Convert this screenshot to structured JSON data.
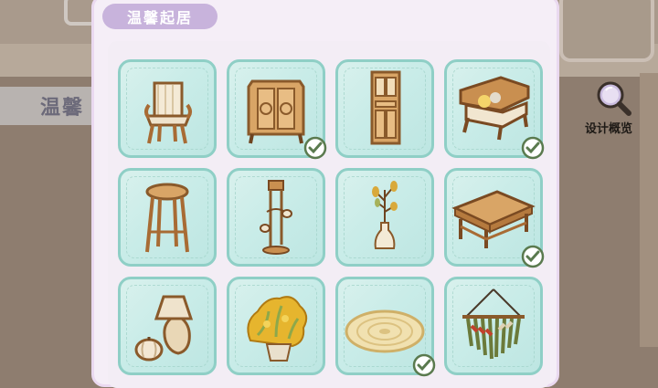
{
  "background": {
    "left_label": "温馨"
  },
  "panel": {
    "title": "温馨起居"
  },
  "overview_button": {
    "label": "设计概览",
    "icon": "magnifier-icon"
  },
  "colors": {
    "tile_fill": "#c9ece8",
    "tile_border": "#8fcfc6",
    "check": "#5a7a4e",
    "title_pill": "#c8b3dc"
  },
  "items": [
    {
      "name": "rattan-armchair",
      "owned": false
    },
    {
      "name": "wooden-cabinet",
      "owned": true
    },
    {
      "name": "tall-bookcase",
      "owned": false
    },
    {
      "name": "rattan-sofa",
      "owned": true
    },
    {
      "name": "bar-stool",
      "owned": false
    },
    {
      "name": "floor-lamp",
      "owned": false
    },
    {
      "name": "branch-vase",
      "owned": false
    },
    {
      "name": "wooden-table",
      "owned": true
    },
    {
      "name": "table-lamp-pumpkin",
      "owned": false
    },
    {
      "name": "yellow-flower-pot",
      "owned": false
    },
    {
      "name": "round-rug",
      "owned": true
    },
    {
      "name": "macrame-hanging",
      "owned": false
    }
  ]
}
